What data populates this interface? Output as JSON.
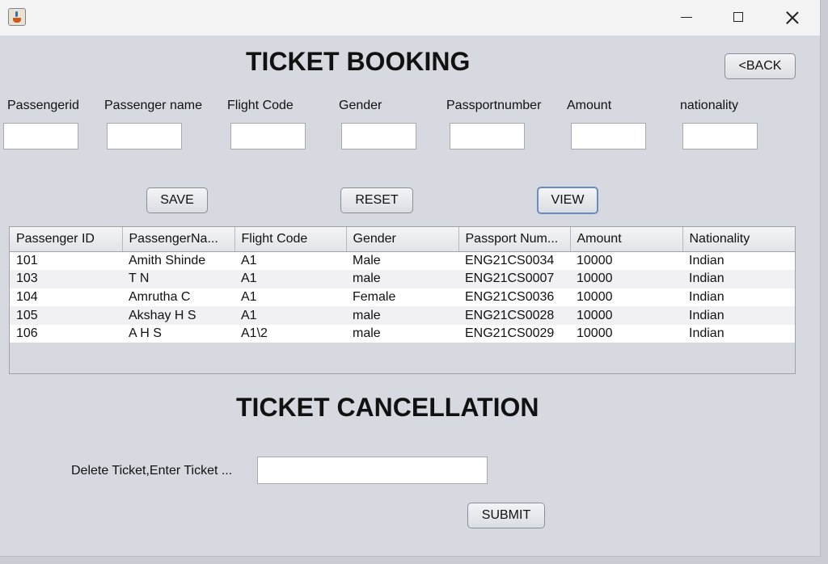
{
  "window": {
    "icon": "java-icon",
    "controls": {
      "minimize": "minimize-icon",
      "maximize": "maximize-icon",
      "close": "close-icon"
    }
  },
  "booking": {
    "title": "TICKET BOOKING",
    "back_label": "<BACK",
    "fields": [
      {
        "label": "Passengerid",
        "value": ""
      },
      {
        "label": "Passenger name",
        "value": ""
      },
      {
        "label": "Flight Code",
        "value": ""
      },
      {
        "label": "Gender",
        "value": ""
      },
      {
        "label": "Passportnumber",
        "value": ""
      },
      {
        "label": "Amount",
        "value": ""
      },
      {
        "label": "nationality",
        "value": ""
      }
    ],
    "save_label": "SAVE",
    "reset_label": "RESET",
    "view_label": "VIEW"
  },
  "table": {
    "headers": [
      "Passenger ID",
      "PassengerNa...",
      "Flight Code",
      "Gender",
      "Passport Num...",
      "Amount",
      "Nationality"
    ],
    "rows": [
      [
        "101",
        "Amith Shinde",
        "A1",
        "Male",
        "ENG21CS0034",
        "10000",
        "Indian"
      ],
      [
        "103",
        "T N",
        "A1",
        "male",
        "ENG21CS0007",
        "10000",
        "Indian"
      ],
      [
        "104",
        "Amrutha C",
        "A1",
        "Female",
        "ENG21CS0036",
        "10000",
        "Indian"
      ],
      [
        "105",
        "Akshay H S",
        "A1",
        "male",
        "ENG21CS0028",
        "10000",
        "Indian"
      ],
      [
        "106",
        "A H S",
        "A1\\2",
        "male",
        "ENG21CS0029",
        "10000",
        "Indian"
      ]
    ]
  },
  "cancellation": {
    "title": "TICKET CANCELLATION",
    "delete_label": "Delete Ticket,Enter Ticket ...",
    "delete_value": "",
    "submit_label": "SUBMIT"
  }
}
